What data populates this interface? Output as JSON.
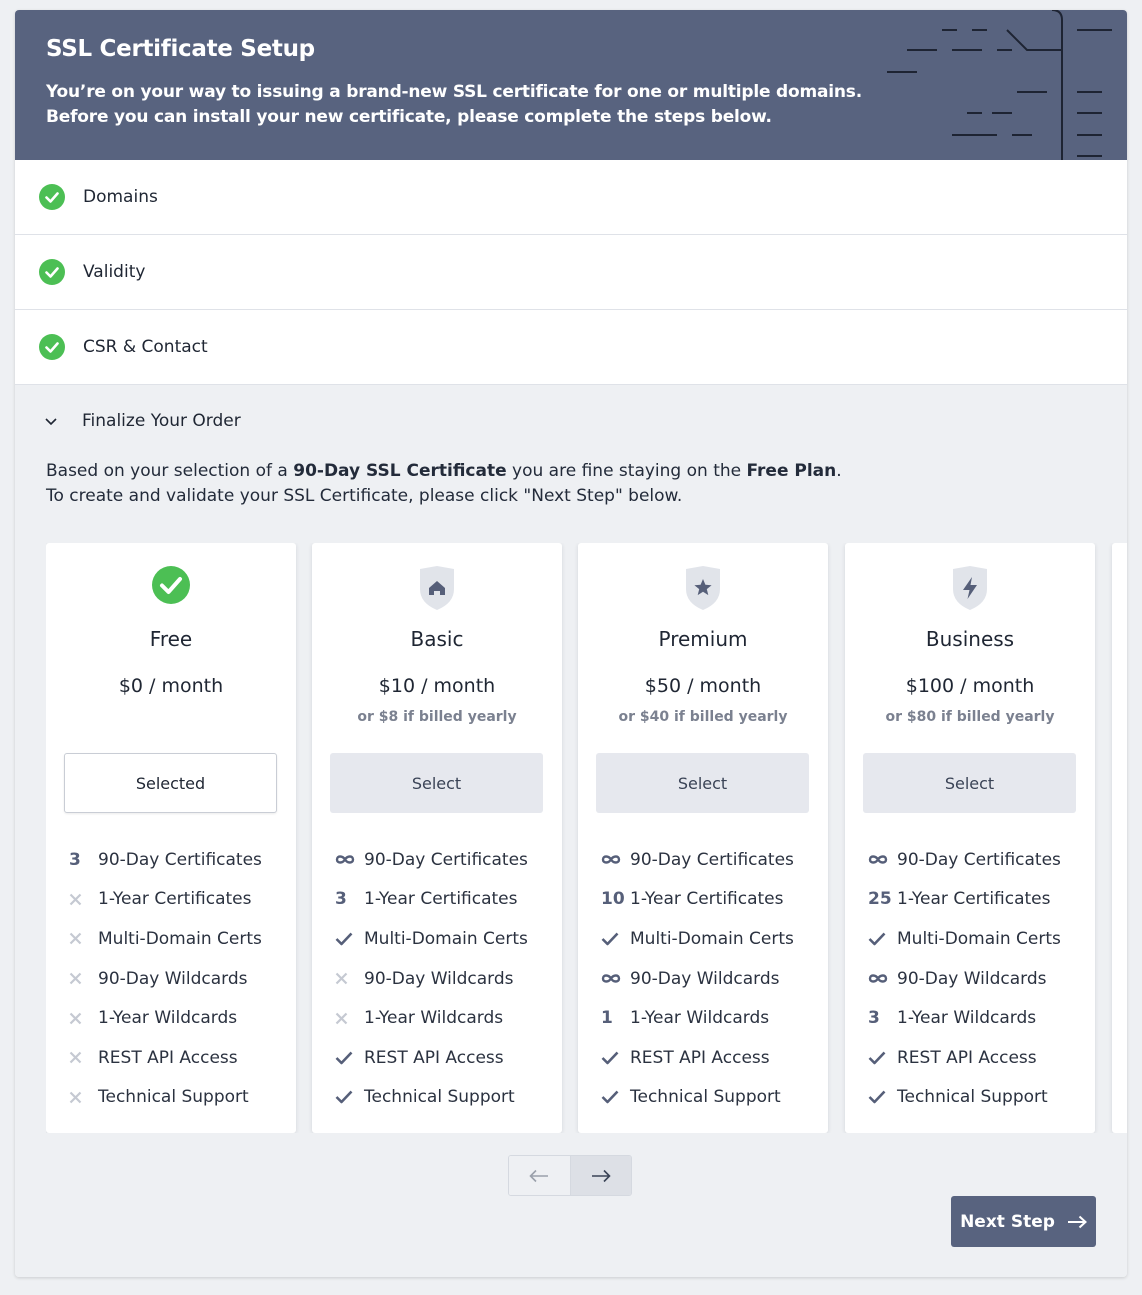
{
  "header": {
    "title": "SSL Certificate Setup",
    "line1": "You’re on your way to issuing a brand-new SSL certificate for one or multiple domains.",
    "line2": "Before you can install your new certificate, please complete the steps below."
  },
  "steps": [
    {
      "label": "Domains",
      "status": "complete"
    },
    {
      "label": "Validity",
      "status": "complete"
    },
    {
      "label": "CSR & Contact",
      "status": "complete"
    }
  ],
  "finalize": {
    "label": "Finalize Your Order",
    "intro": {
      "p1_a": "Based on your selection of a ",
      "p1_b": "90-Day SSL Certificate",
      "p1_c": " you are fine staying on the ",
      "p1_d": "Free Plan",
      "p1_e": ".",
      "p2": "To create and validate your SSL Certificate, please click \"Next Step\" below."
    }
  },
  "plans": [
    {
      "name": "Free",
      "price": "$0 / month",
      "yearly": "",
      "button": "Selected",
      "selected": true,
      "icon": "check-circle-icon",
      "features": [
        {
          "icon": "num",
          "value": "3",
          "label": "90-Day Certificates"
        },
        {
          "icon": "cross",
          "value": "",
          "label": "1-Year Certificates"
        },
        {
          "icon": "cross",
          "value": "",
          "label": "Multi-Domain Certs"
        },
        {
          "icon": "cross",
          "value": "",
          "label": "90-Day Wildcards"
        },
        {
          "icon": "cross",
          "value": "",
          "label": "1-Year Wildcards"
        },
        {
          "icon": "cross",
          "value": "",
          "label": "REST API Access"
        },
        {
          "icon": "cross",
          "value": "",
          "label": "Technical Support"
        }
      ]
    },
    {
      "name": "Basic",
      "price": "$10 / month",
      "yearly": "or $8 if billed yearly",
      "button": "Select",
      "selected": false,
      "icon": "shield-home-icon",
      "features": [
        {
          "icon": "infinity",
          "value": "",
          "label": "90-Day Certificates"
        },
        {
          "icon": "num",
          "value": "3",
          "label": "1-Year Certificates"
        },
        {
          "icon": "check",
          "value": "",
          "label": "Multi-Domain Certs"
        },
        {
          "icon": "cross",
          "value": "",
          "label": "90-Day Wildcards"
        },
        {
          "icon": "cross",
          "value": "",
          "label": "1-Year Wildcards"
        },
        {
          "icon": "check",
          "value": "",
          "label": "REST API Access"
        },
        {
          "icon": "check",
          "value": "",
          "label": "Technical Support"
        }
      ]
    },
    {
      "name": "Premium",
      "price": "$50 / month",
      "yearly": "or $40 if billed yearly",
      "button": "Select",
      "selected": false,
      "icon": "shield-star-icon",
      "features": [
        {
          "icon": "infinity",
          "value": "",
          "label": "90-Day Certificates"
        },
        {
          "icon": "num",
          "value": "10",
          "label": "1-Year Certificates"
        },
        {
          "icon": "check",
          "value": "",
          "label": "Multi-Domain Certs"
        },
        {
          "icon": "infinity",
          "value": "",
          "label": "90-Day Wildcards"
        },
        {
          "icon": "num",
          "value": "1",
          "label": "1-Year Wildcards"
        },
        {
          "icon": "check",
          "value": "",
          "label": "REST API Access"
        },
        {
          "icon": "check",
          "value": "",
          "label": "Technical Support"
        }
      ]
    },
    {
      "name": "Business",
      "price": "$100 / month",
      "yearly": "or $80 if billed yearly",
      "button": "Select",
      "selected": false,
      "icon": "shield-bolt-icon",
      "features": [
        {
          "icon": "infinity",
          "value": "",
          "label": "90-Day Certificates"
        },
        {
          "icon": "num",
          "value": "25",
          "label": "1-Year Certificates"
        },
        {
          "icon": "check",
          "value": "",
          "label": "Multi-Domain Certs"
        },
        {
          "icon": "infinity",
          "value": "",
          "label": "90-Day Wildcards"
        },
        {
          "icon": "num",
          "value": "3",
          "label": "1-Year Wildcards"
        },
        {
          "icon": "check",
          "value": "",
          "label": "REST API Access"
        },
        {
          "icon": "check",
          "value": "",
          "label": "Technical Support"
        }
      ]
    }
  ],
  "next_button": "Next Step",
  "colors": {
    "header_bg": "#58637f",
    "success": "#4cbf54",
    "accent": "#58637f",
    "muted_icon": "#c5c9d2"
  }
}
